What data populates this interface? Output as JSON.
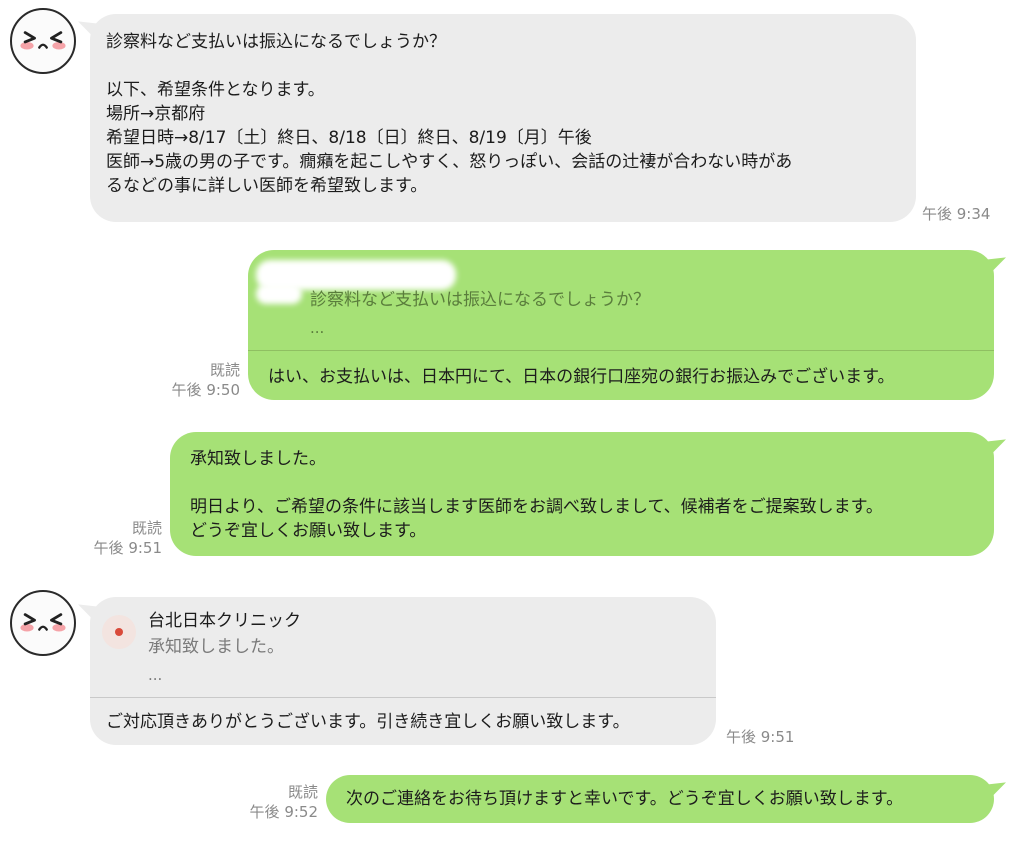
{
  "avatar_icon": "blushing-face-icon",
  "read_label": "既読",
  "messages": {
    "m1": {
      "lines": [
        "診察料など支払いは振込になるでしょうか？",
        "",
        "以下、希望条件となります。",
        "場所→京都府",
        "希望日時→8/17〔土〕終日、8/18〔日〕終日、8/19〔月〕午後",
        "医師→5歳の男の子です。癇癪を起こしやすく、怒りっぽい、会話の辻褄が合わない時があ",
        "るなどの事に詳しい医師を希望致します。"
      ],
      "time": "午後 9:34"
    },
    "m2": {
      "quote_text": "診察料など支払いは振込になるでしょうか？",
      "quote_ellipsis": "...",
      "reply": "はい、お支払いは、日本円にて、日本の銀行口座宛の銀行お振込みでございます。",
      "time": "午後 9:50"
    },
    "m3": {
      "lines": [
        "承知致しました。",
        "",
        "明日より、ご希望の条件に該当します医師をお調べ致しまして、候補者をご提案致します。",
        "どうぞ宜しくお願い致します。"
      ],
      "time": "午後 9:51"
    },
    "m4": {
      "quote_name": "台北日本クリニック",
      "quote_text": "承知致しました。",
      "quote_ellipsis": "...",
      "reply": "ご対応頂きありがとうございます。引き続き宜しくお願い致します。",
      "time": "午後 9:51"
    },
    "m5": {
      "text": "次のご連絡をお待ち頂けますと幸いです。どうぞ宜しくお願い致します。",
      "time": "午後 9:52"
    }
  },
  "colors": {
    "received_bubble": "#ececec",
    "sent_bubble": "#a6e176",
    "timestamp": "#8a8a8a"
  }
}
